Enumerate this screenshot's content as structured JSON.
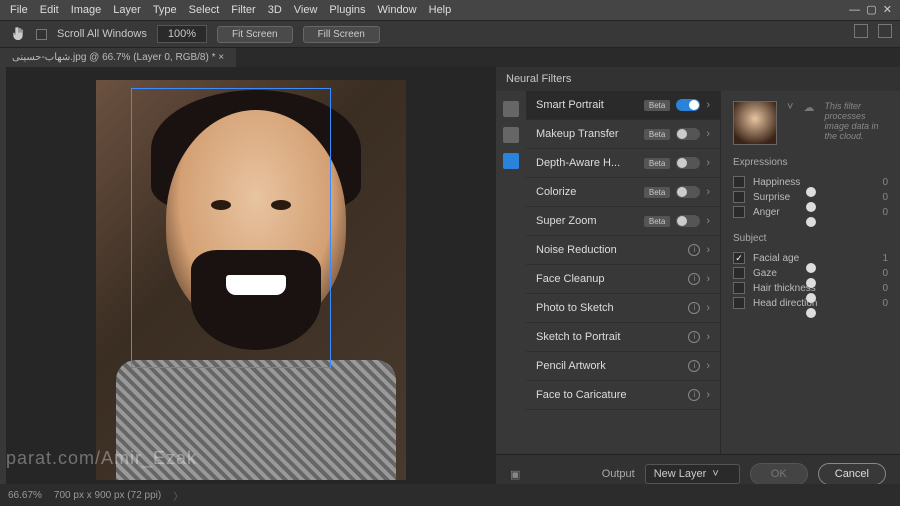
{
  "menu": [
    "File",
    "Edit",
    "Image",
    "Layer",
    "Type",
    "Select",
    "Filter",
    "3D",
    "View",
    "Plugins",
    "Window",
    "Help"
  ],
  "options": {
    "scroll_all": "Scroll All Windows",
    "zoom": "100%",
    "fit1": "Fit Screen",
    "fit2": "Fill Screen"
  },
  "tab": "شهاب-حسینی.jpg @ 66.7% (Layer 0, RGB/8) *",
  "panel_title": "Neural Filters",
  "filters": [
    {
      "name": "Smart Portrait",
      "badge": "Beta",
      "on": true,
      "sel": true
    },
    {
      "name": "Makeup Transfer",
      "badge": "Beta",
      "on": false
    },
    {
      "name": "Depth-Aware H...",
      "badge": "Beta",
      "on": false
    },
    {
      "name": "Colorize",
      "badge": "Beta",
      "on": false
    },
    {
      "name": "Super Zoom",
      "badge": "Beta",
      "on": false
    },
    {
      "name": "Noise Reduction",
      "info": true
    },
    {
      "name": "Face Cleanup",
      "info": true
    },
    {
      "name": "Photo to Sketch",
      "info": true
    },
    {
      "name": "Sketch to Portrait",
      "info": true
    },
    {
      "name": "Pencil Artwork",
      "info": true
    },
    {
      "name": "Face to Caricature",
      "info": true
    }
  ],
  "cloud_msg": "This filter processes image data in the cloud.",
  "sections": {
    "expressions": "Expressions",
    "subject": "Subject"
  },
  "sliders": [
    {
      "label": "Happiness",
      "val": "0",
      "chk": false
    },
    {
      "label": "Surprise",
      "val": "0",
      "chk": false
    },
    {
      "label": "Anger",
      "val": "0",
      "chk": false
    },
    {
      "label": "Facial age",
      "val": "1",
      "chk": true
    },
    {
      "label": "Gaze",
      "val": "0",
      "chk": false
    },
    {
      "label": "Hair thickness",
      "val": "0",
      "chk": false
    },
    {
      "label": "Head direction",
      "val": "0",
      "chk": false
    }
  ],
  "footer": {
    "output_label": "Output",
    "output_value": "New Layer",
    "ok": "OK",
    "cancel": "Cancel"
  },
  "status": {
    "zoom": "66.67%",
    "dim": "700 px x 900 px (72 ppi)"
  },
  "watermark": "parat.com/Amir_Ezak"
}
